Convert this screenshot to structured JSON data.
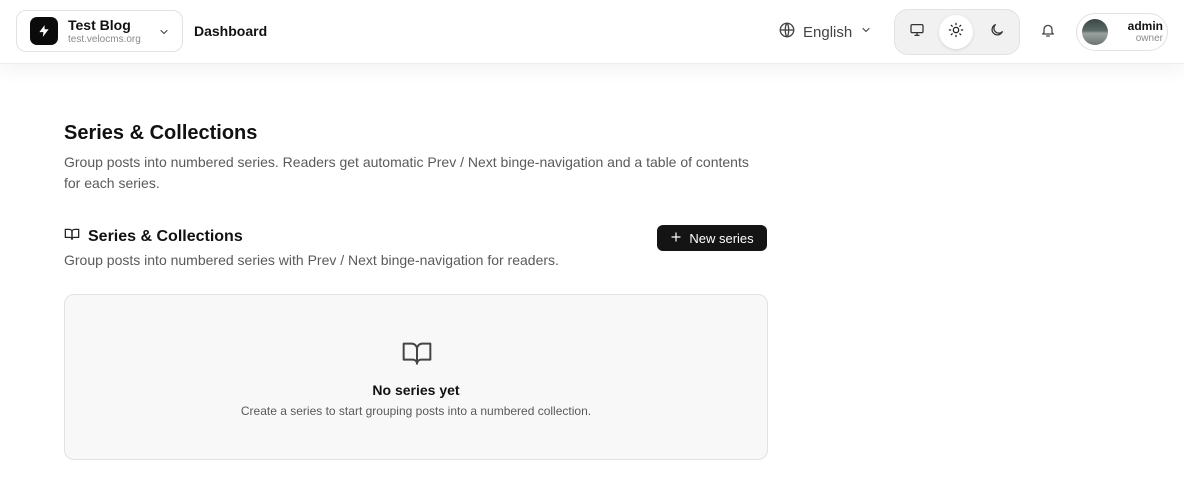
{
  "header": {
    "site": {
      "name": "Test Blog",
      "domain": "test.velocms.org",
      "logo_icon": "bolt-icon"
    },
    "breadcrumb": "Dashboard",
    "language": {
      "label": "English",
      "icon": "globe-icon"
    },
    "theme": {
      "options": [
        "system",
        "light",
        "dark"
      ],
      "selected": "light"
    },
    "notifications_icon": "bell-icon",
    "user": {
      "name": "admin",
      "role": "owner"
    }
  },
  "main": {
    "title": "Series & Collections",
    "description": "Group posts into numbered series. Readers get automatic Prev / Next binge-navigation and a table of contents for each series.",
    "section": {
      "icon": "book-open-icon",
      "title": "Series & Collections",
      "description": "Group posts into numbered series with Prev / Next binge-navigation for readers.",
      "new_button_label": "New series"
    },
    "empty_state": {
      "icon": "book-open-icon",
      "title": "No series yet",
      "description": "Create a series to start grouping posts into a numbered collection."
    }
  },
  "colors": {
    "primary_button": "#141414",
    "card_background": "#f8f8f8",
    "muted_text": "#5a5a5a"
  }
}
